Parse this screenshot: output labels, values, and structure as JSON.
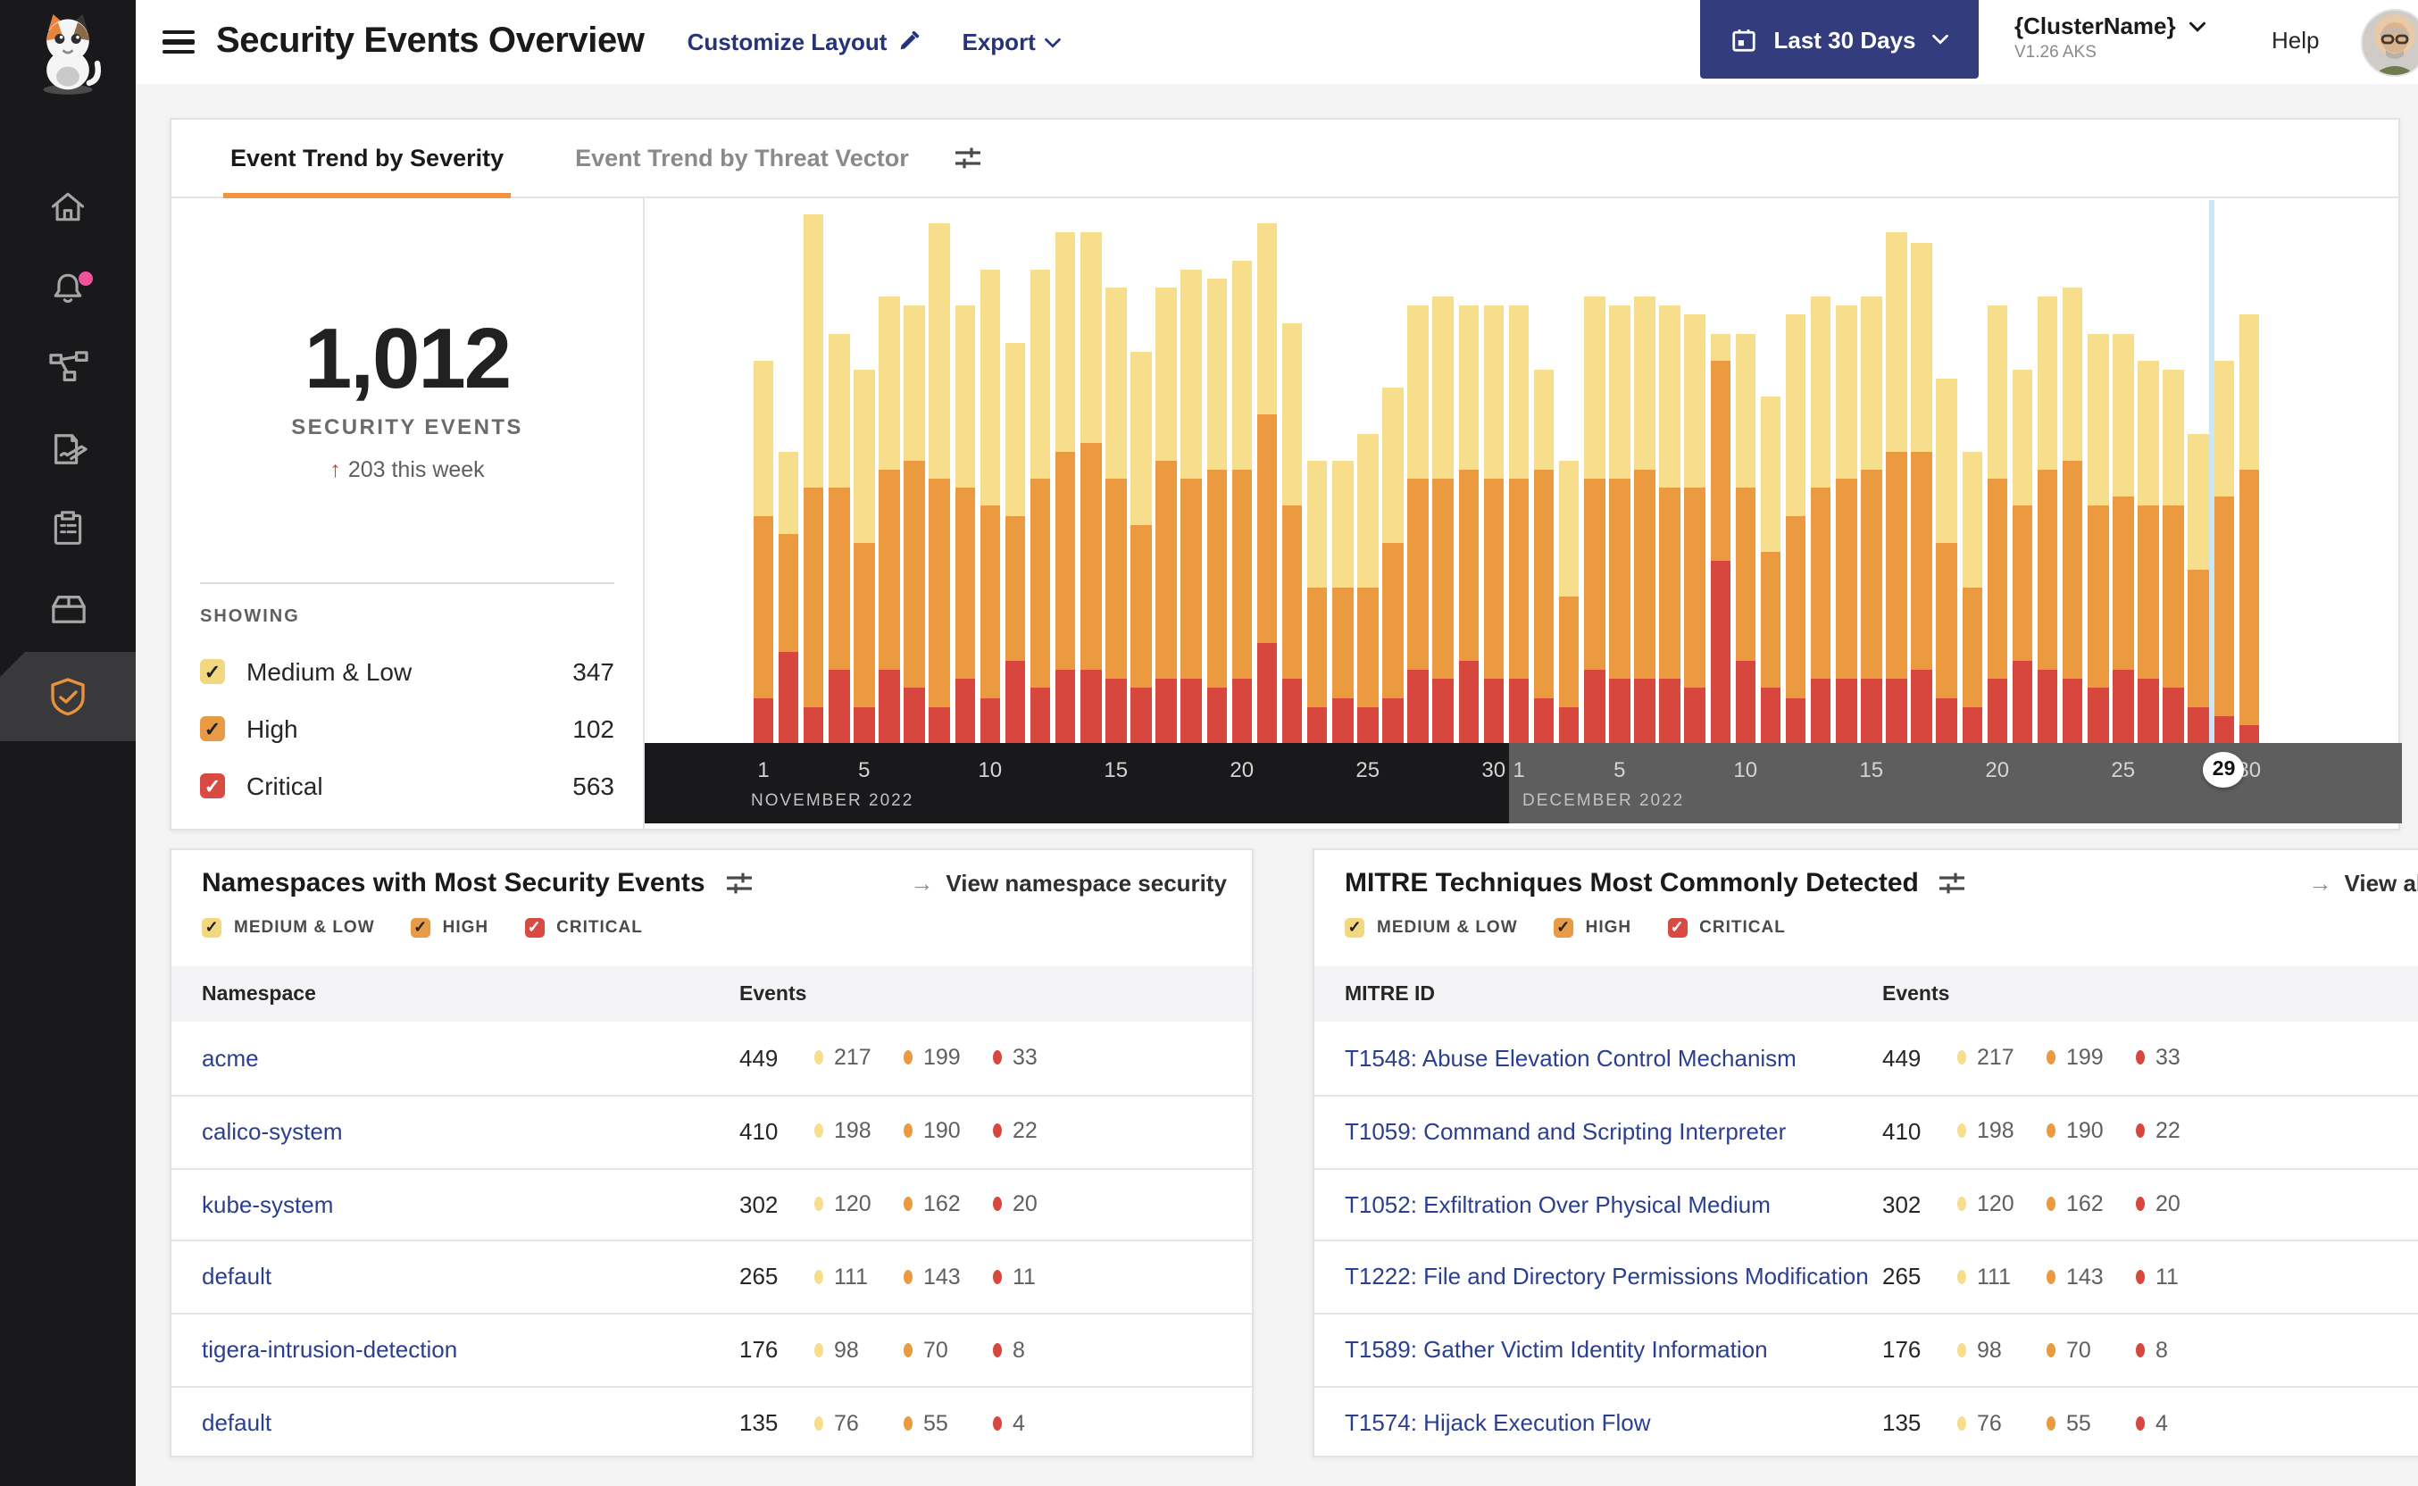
{
  "header": {
    "title": "Security Events Overview",
    "customize_layout": "Customize Layout",
    "export": "Export",
    "date_range": "Last 30 Days",
    "cluster_name": "{ClusterName}",
    "cluster_version": "V1.26 AKS",
    "help": "Help"
  },
  "sidebar": {
    "items": [
      "home",
      "alerts",
      "service-graph",
      "policies",
      "compliance-reports",
      "workloads",
      "threat-defense"
    ],
    "active_item": "threat-defense",
    "alert_badge": true
  },
  "tabs": {
    "severity": "Event Trend by Severity",
    "threat_vector": "Event Trend by Threat Vector"
  },
  "stats": {
    "total": "1,012",
    "label": "SECURITY EVENTS",
    "delta_arrow": "↑",
    "delta": "203 this week",
    "showing_label": "SHOWING",
    "legend": [
      {
        "label": "Medium & Low",
        "count": "347",
        "color": "#F2D980",
        "check": "dark"
      },
      {
        "label": "High",
        "count": "102",
        "color": "#E89A44",
        "check": "dark"
      },
      {
        "label": "Critical",
        "count": "563",
        "color": "#D84B42",
        "check": "white"
      }
    ]
  },
  "filter_chips": [
    {
      "label": "MEDIUM & LOW",
      "color": "#F2D980",
      "check": "dark"
    },
    {
      "label": "HIGH",
      "color": "#E89A44",
      "check": "dark"
    },
    {
      "label": "CRITICAL",
      "color": "#D84B42",
      "check": "white"
    }
  ],
  "chart_data": {
    "type": "bar",
    "stacked": true,
    "title": "",
    "xlabel": "",
    "ylabel": "",
    "ylim": [
      0,
      60
    ],
    "grid": false,
    "x_months": [
      {
        "label": "NOVEMBER 2022",
        "days": 30,
        "ticks": [
          1,
          5,
          10,
          15,
          20,
          25,
          30
        ]
      },
      {
        "label": "DECEMBER 2022",
        "days": 30,
        "ticks": [
          1,
          5,
          10,
          15,
          20,
          25,
          30
        ]
      }
    ],
    "selected_day": {
      "month": "DECEMBER 2022",
      "day": "29"
    },
    "series": [
      {
        "name": "Medium & Low",
        "color": "#F6DE8D",
        "values": [
          17,
          9,
          30,
          17,
          19,
          19,
          17,
          28,
          20,
          26,
          19,
          23,
          24,
          23,
          21,
          19,
          19,
          23,
          21,
          23,
          21,
          20,
          14,
          14,
          17,
          17,
          19,
          20,
          18,
          19,
          19,
          11,
          15,
          20,
          19,
          19,
          20,
          19,
          3,
          17,
          17,
          22,
          21,
          19,
          19,
          24,
          23,
          18,
          15,
          19,
          15,
          19,
          19,
          19,
          18,
          16,
          15,
          15,
          15,
          17
        ]
      },
      {
        "name": "High",
        "color": "#EC9A3F",
        "values": [
          20,
          13,
          24,
          20,
          18,
          22,
          25,
          25,
          21,
          21,
          16,
          23,
          24,
          25,
          22,
          18,
          24,
          22,
          24,
          23,
          25,
          19,
          13,
          12,
          13,
          17,
          21,
          22,
          21,
          22,
          22,
          25,
          12,
          21,
          22,
          23,
          21,
          22,
          22,
          19,
          15,
          20,
          21,
          22,
          23,
          25,
          24,
          17,
          13,
          22,
          17,
          22,
          24,
          20,
          19,
          19,
          20,
          15,
          24,
          28
        ]
      },
      {
        "name": "Critical",
        "color": "#D8473D",
        "values": [
          5,
          10,
          4,
          8,
          4,
          8,
          6,
          4,
          7,
          5,
          9,
          6,
          8,
          8,
          7,
          6,
          7,
          7,
          6,
          7,
          11,
          7,
          4,
          5,
          4,
          5,
          8,
          7,
          9,
          7,
          7,
          5,
          4,
          8,
          7,
          7,
          7,
          6,
          20,
          9,
          6,
          5,
          7,
          7,
          7,
          7,
          8,
          5,
          4,
          7,
          9,
          8,
          7,
          6,
          8,
          7,
          6,
          4,
          3,
          2
        ]
      }
    ]
  },
  "namespaces_card": {
    "title": "Namespaces with Most Security Events",
    "link": "View namespace security",
    "col1": "Namespace",
    "col2": "Events",
    "rows": [
      {
        "name": "acme",
        "total": "449",
        "medium_low": "217",
        "high": "199",
        "critical": "33"
      },
      {
        "name": "calico-system",
        "total": "410",
        "medium_low": "198",
        "high": "190",
        "critical": "22"
      },
      {
        "name": "kube-system",
        "total": "302",
        "medium_low": "120",
        "high": "162",
        "critical": "20"
      },
      {
        "name": "default",
        "total": "265",
        "medium_low": "111",
        "high": "143",
        "critical": "11"
      },
      {
        "name": "tigera-intrusion-detection",
        "total": "176",
        "medium_low": "98",
        "high": "70",
        "critical": "8"
      },
      {
        "name": "default",
        "total": "135",
        "medium_low": "76",
        "high": "55",
        "critical": "4"
      }
    ]
  },
  "mitre_card": {
    "title": "MITRE Techniques Most Commonly Detected",
    "link": "View all events",
    "col1": "MITRE ID",
    "col2": "Events",
    "rows": [
      {
        "name": "T1548: Abuse Elevation Control Mechanism",
        "total": "449",
        "medium_low": "217",
        "high": "199",
        "critical": "33"
      },
      {
        "name": "T1059: Command and Scripting Interpreter",
        "total": "410",
        "medium_low": "198",
        "high": "190",
        "critical": "22"
      },
      {
        "name": "T1052: Exfiltration Over Physical Medium",
        "total": "302",
        "medium_low": "120",
        "high": "162",
        "critical": "20"
      },
      {
        "name": "T1222: File and Directory Permissions Modification",
        "total": "265",
        "medium_low": "111",
        "high": "143",
        "critical": "11"
      },
      {
        "name": "T1589: Gather Victim Identity Information",
        "total": "176",
        "medium_low": "98",
        "high": "70",
        "critical": "8"
      },
      {
        "name": "T1574: Hijack Execution Flow",
        "total": "135",
        "medium_low": "76",
        "high": "55",
        "critical": "4"
      }
    ]
  },
  "colors": {
    "medium_low": "#F6DE8D",
    "high": "#EC9A3F",
    "critical": "#D8473D",
    "accent_orange": "#F0953F",
    "navy_button": "#333D7E",
    "link_navy": "#2B3F8F",
    "axis_november_bg": "#19191B",
    "axis_december_bg": "#5E5E5E",
    "highlight_line": "#CBE7F5",
    "notification_pink": "#F0519B"
  }
}
